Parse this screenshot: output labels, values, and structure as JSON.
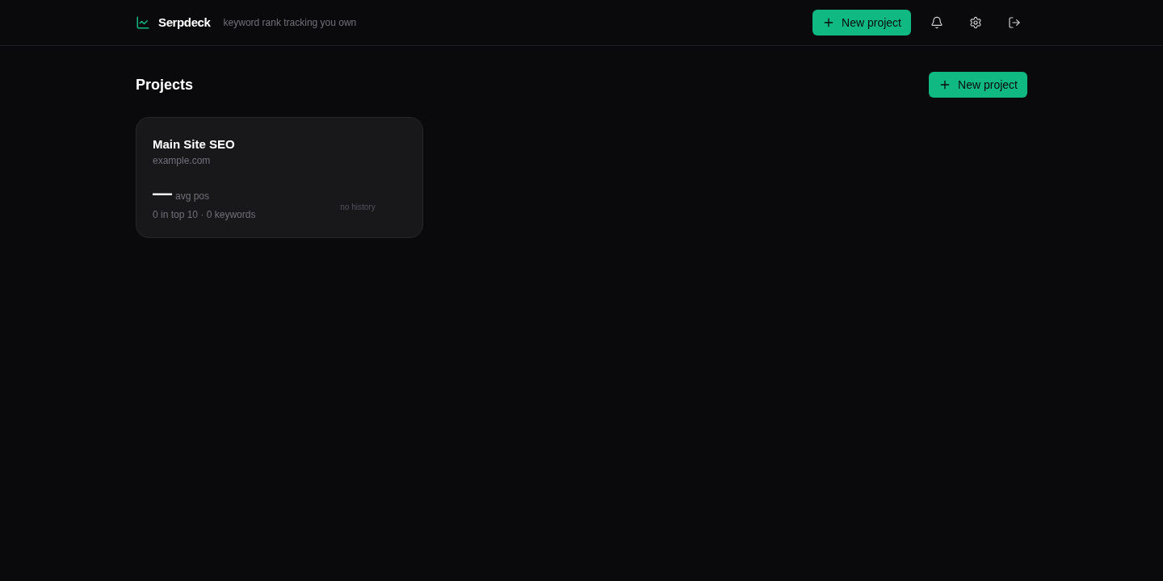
{
  "header": {
    "brand": "Serpdeck",
    "tagline": "keyword rank tracking you own",
    "new_button": "New project"
  },
  "page": {
    "title": "Projects",
    "new_button": "New project"
  },
  "projects": [
    {
      "name": "Main Site SEO",
      "domain": "example.com",
      "avg_pos": "—",
      "avg_pos_label": "avg pos",
      "summary": "0 in top 10 · 0 keywords",
      "history": "no history"
    }
  ]
}
